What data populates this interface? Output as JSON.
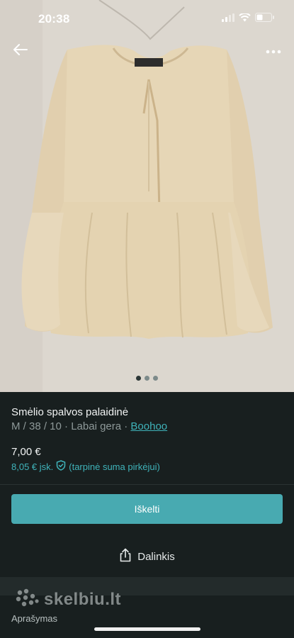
{
  "status_bar": {
    "time": "20:38"
  },
  "nav": {
    "back_icon": "arrow-left-icon",
    "more_icon": "more-horizontal-icon"
  },
  "gallery": {
    "image_count": 3,
    "active_index": 0
  },
  "item": {
    "title": "Smėlio spalvos palaidinė",
    "attributes": "M / 38 / 10 · Labai gera · ",
    "brand": "Boohoo",
    "price": "7,00 €",
    "buyer_price": "8,05 € jsk.",
    "buyer_note": "(tarpinė suma pirkėjui)"
  },
  "actions": {
    "buy_label": "Iškelti",
    "share_label": "Dalinkis"
  },
  "description": {
    "label": "Aprašymas"
  },
  "watermark": {
    "text": "skelbiu.lt"
  },
  "colors": {
    "accent": "#48aab1",
    "link": "#3fb3ba",
    "background": "#181f1f"
  }
}
